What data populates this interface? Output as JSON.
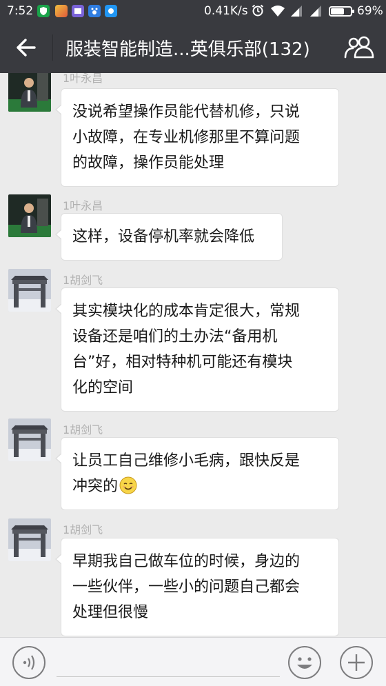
{
  "status_bar": {
    "time": "7:52",
    "network_speed": "0.41K/s",
    "battery_percent": "69%",
    "battery_level": 0.69,
    "app_icons": [
      {
        "name": "shield-app-icon",
        "color": "#1aa34a"
      },
      {
        "name": "game-app-icon",
        "color": "#e8a530"
      },
      {
        "name": "mail-app-icon",
        "color": "#7a63d8"
      },
      {
        "name": "baidu-app-icon",
        "color": "#2f7de1"
      },
      {
        "name": "chat-app-icon",
        "color": "#2196f3"
      }
    ]
  },
  "header": {
    "title": "服装智能制造...英俱乐部(132)",
    "back_icon": "arrow-left-icon",
    "members_icon": "group-members-icon"
  },
  "messages": [
    {
      "sender": "1叶永昌",
      "avatar": "ye-avatar",
      "lines": [
        "没说希望操作员能代替机修，只说",
        "小故障，在专业机修那里不算问题",
        "的故障，操作员能处理"
      ]
    },
    {
      "sender": "1叶永昌",
      "avatar": "ye-avatar",
      "lines": [
        "这样，设备停机率就会降低"
      ]
    },
    {
      "sender": "1胡剑飞",
      "avatar": "hu-avatar",
      "lines": [
        "其实模块化的成本肯定很大，常规",
        "设备还是咱们的土办法“备用机",
        "台”好，相对特种机可能还有模块",
        "化的空间"
      ]
    },
    {
      "sender": "1胡剑飞",
      "avatar": "hu-avatar",
      "lines": [
        "让员工自己维修小毛病，跟快反是",
        "冲突的"
      ],
      "trailing_emoji": "smile-emoji-icon"
    },
    {
      "sender": "1胡剑飞",
      "avatar": "hu-avatar",
      "lines": [
        "早期我自己做车位的时候，身边的",
        "一些伙伴，一些小的问题自己都会",
        "处理但很慢"
      ]
    }
  ],
  "input_bar": {
    "voice_icon": "voice-icon",
    "emoji_icon": "emoji-icon",
    "plus_icon": "plus-icon"
  }
}
